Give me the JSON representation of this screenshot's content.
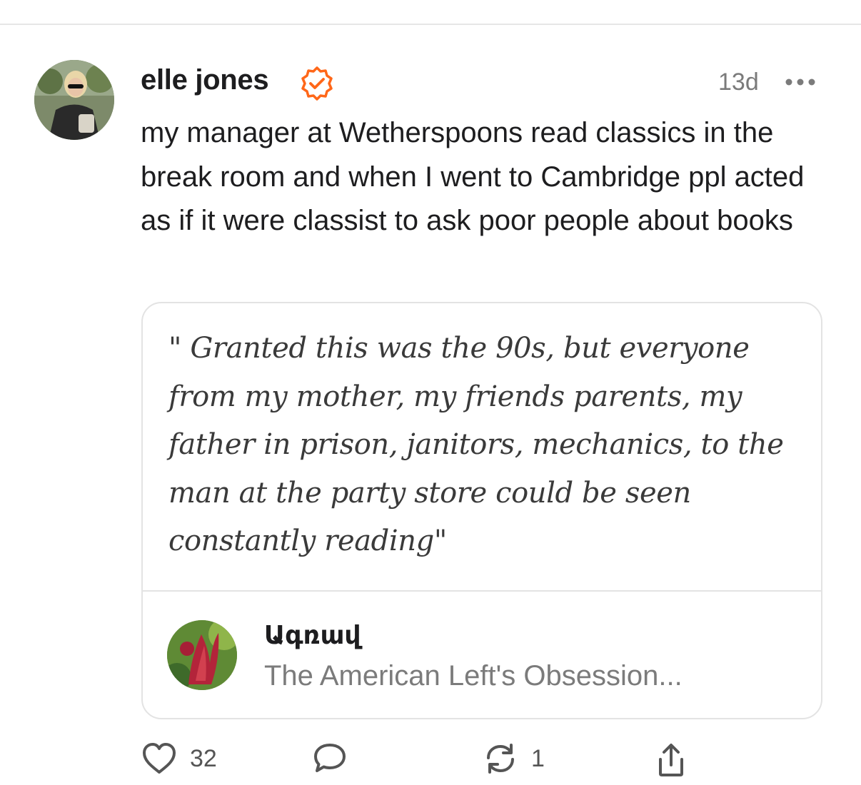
{
  "post": {
    "author_name": "elle jones",
    "timestamp": "13d",
    "text": "my manager at Wetherspoons read classics in the break room and when I went to Cambridge ppl acted as if it were classist to ask poor people about books"
  },
  "embed": {
    "quote": "\" Granted this was the 90s, but everyone from my mother, my friends parents, my father in prison, janitors, mechanics, to the man at the party store could be seen constantly reading\"",
    "publication_name": "Ագռավ",
    "article_title": "The American Left's Obsession..."
  },
  "actions": {
    "like_count": "32",
    "restack_count": "1"
  },
  "colors": {
    "verified_accent": "#ff6719",
    "text_primary": "#1d1d1f",
    "text_secondary": "#7b7b7b",
    "border": "#e3e3e3"
  },
  "icons": [
    "verified-icon",
    "more-icon",
    "heart-icon",
    "comment-icon",
    "restack-icon",
    "share-icon"
  ]
}
